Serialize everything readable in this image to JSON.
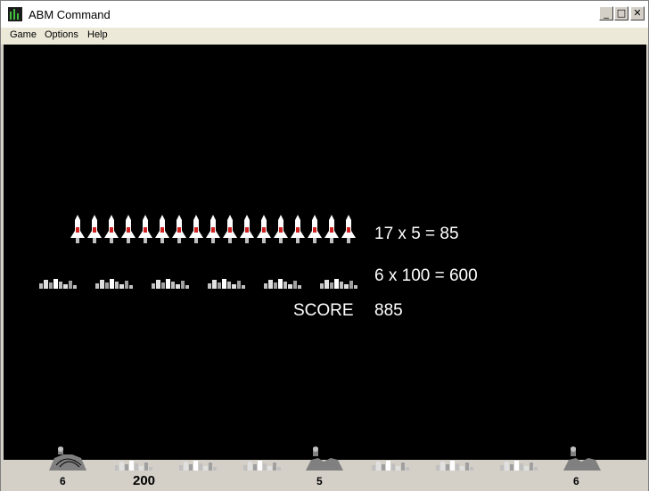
{
  "window": {
    "title": "ABM Command",
    "min_label": "_",
    "max_label": "□",
    "close_label": "✕"
  },
  "menu": {
    "items": [
      "Game",
      "Options",
      "Help"
    ]
  },
  "bonus": {
    "missiles_count": 17,
    "missile_line": "17 x 5 = 85",
    "cities_count": 6,
    "city_line": "6 x 100 = 600",
    "score_label": "SCORE",
    "score_value": "885"
  },
  "status_bar": {
    "left_base_ammo": "6",
    "score": "200",
    "center_base_ammo": "5",
    "right_base_ammo": "6"
  },
  "colors": {
    "background": "#000000",
    "text": "#ffffff",
    "missile_body": "#ffffff",
    "missile_accent": "#d02020",
    "city": "#c0c0c0",
    "ground": "#d4d0c8",
    "base": "#808080"
  }
}
